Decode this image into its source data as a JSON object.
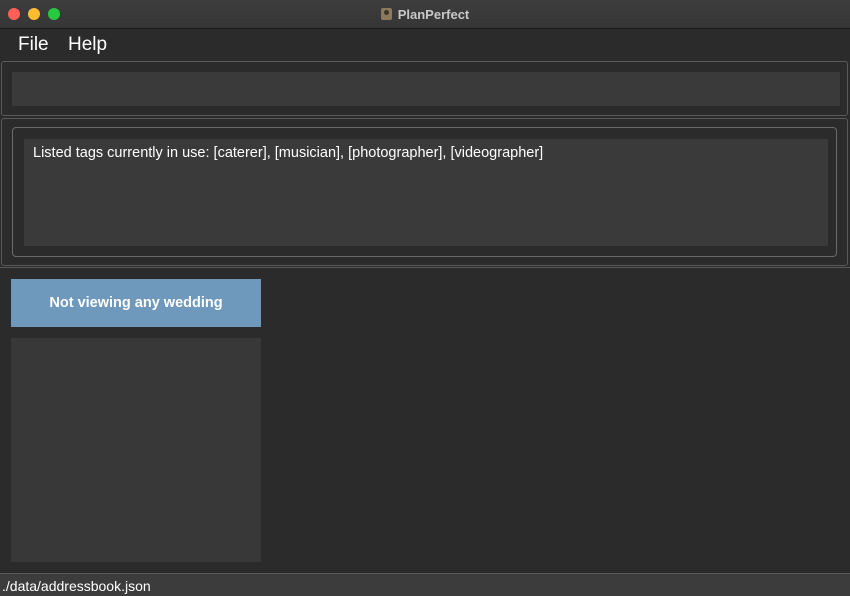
{
  "window": {
    "title": "PlanPerfect",
    "app_icon": "contacts-app-icon"
  },
  "menu": {
    "items": [
      {
        "label": "File"
      },
      {
        "label": "Help"
      }
    ]
  },
  "command_box": {
    "value": "",
    "placeholder": ""
  },
  "result_display": {
    "text": "Listed tags currently in use: [caterer], [musician], [photographer], [videographer]"
  },
  "wedding_panel": {
    "header_label": "Not viewing any wedding",
    "header_color": "#6e98bc"
  },
  "status_bar": {
    "file_path": "./data/addressbook.json"
  },
  "colors": {
    "background": "#2b2b2b",
    "panel": "#3a3a3a",
    "close": "#fe5f57",
    "minimize": "#febc2e",
    "zoom": "#28c840"
  }
}
